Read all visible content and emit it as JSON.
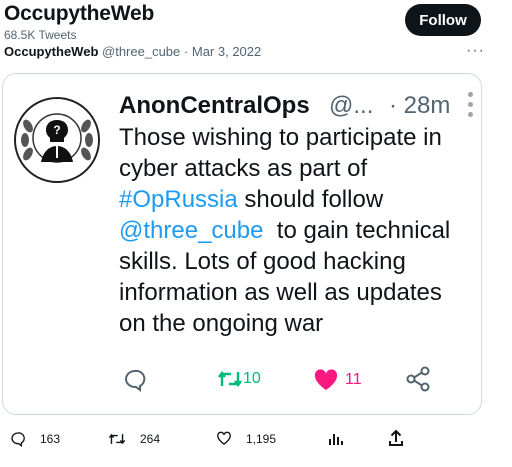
{
  "profile": {
    "name": "OccupytheWeb",
    "tweet_count": "68.5K Tweets",
    "follow_label": "Follow"
  },
  "tweet": {
    "author_name": "OccupytheWeb",
    "author_handle": "@three_cube",
    "separator": "·",
    "date": "Mar 3, 2022",
    "more": "···"
  },
  "quoted": {
    "name": "AnonCentralOps",
    "handle": "@...",
    "time": "· 28m",
    "text_lines": [
      "Those wishing to participate in",
      "cyber attacks as part of",
      "#OpRussia",
      " should follow",
      "@three_cube",
      "  to gain technical",
      "skills. Lots of good hacking",
      "information as well as updates",
      "on the ongoing war"
    ],
    "retweets": "10",
    "likes": "11"
  },
  "actions": {
    "replies": "163",
    "retweets": "264",
    "likes": "1,195"
  },
  "colors": {
    "link": "#1d9bf0",
    "retweet": "#00ba7c",
    "like": "#f91880",
    "muted": "#536471"
  }
}
